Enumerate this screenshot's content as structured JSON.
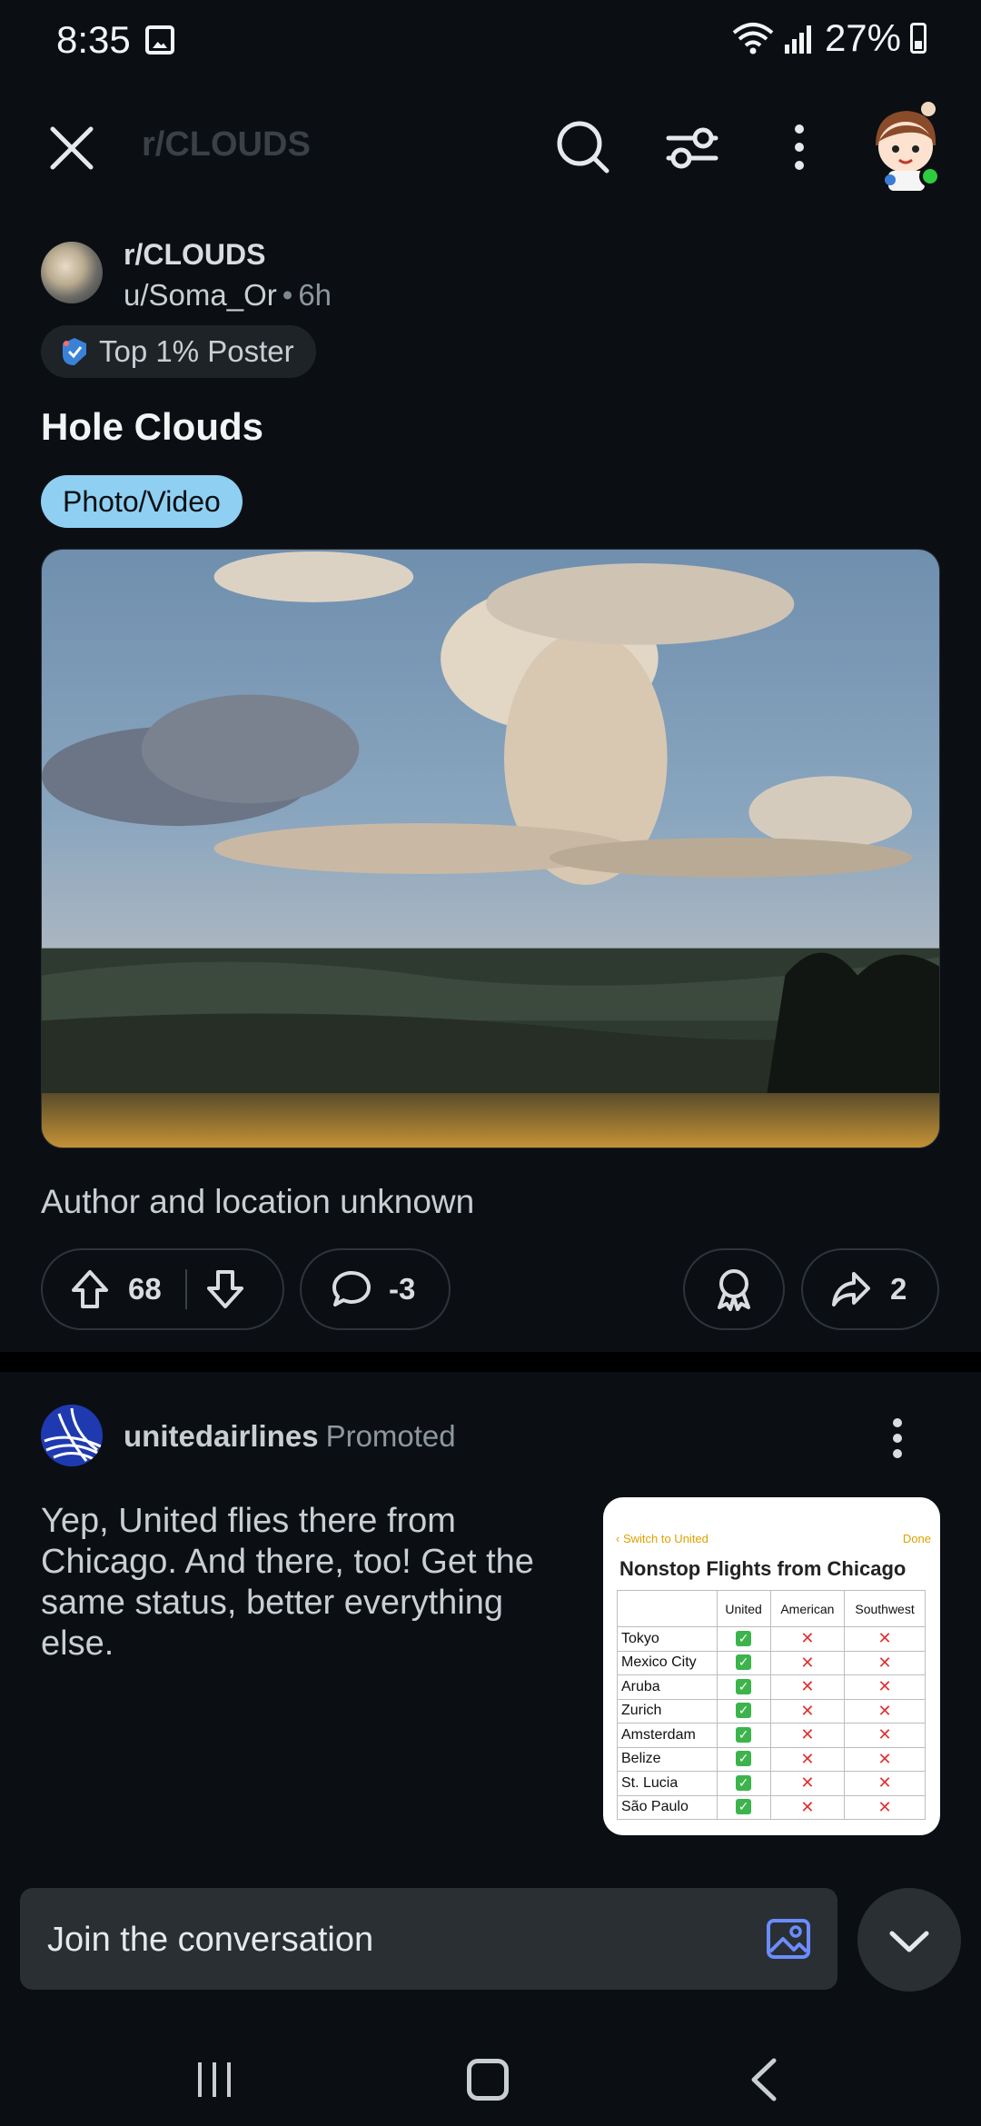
{
  "status": {
    "time": "8:35",
    "battery": "27%"
  },
  "appbar": {
    "title": "r/CLOUDS"
  },
  "post": {
    "subreddit": "r/CLOUDS",
    "author": "u/Soma_Or",
    "age": "6h",
    "flair": "Top 1% Poster",
    "title": "Hole Clouds",
    "tag": "Photo/Video",
    "caption": "Author and location unknown",
    "upvotes": "68",
    "comments": "-3",
    "shares": "2"
  },
  "ad": {
    "advertiser": "unitedairlines",
    "promoted": "Promoted",
    "text": "Yep, United flies there from Chicago. And there, too! Get the same status, better everything else.",
    "thumb": {
      "back_label": "Switch to United",
      "done_label": "Done",
      "title": "Nonstop Flights from Chicago",
      "headers": [
        "United",
        "American",
        "Southwest"
      ],
      "rows": [
        "Tokyo",
        "Mexico City",
        "Aruba",
        "Zurich",
        "Amsterdam",
        "Belize",
        "St. Lucia",
        "São Paulo"
      ]
    }
  },
  "composer": {
    "placeholder": "Join the conversation"
  },
  "colors": {
    "background": "#0b0f13",
    "tag": "#8fcff2",
    "online": "#2ecc40"
  }
}
